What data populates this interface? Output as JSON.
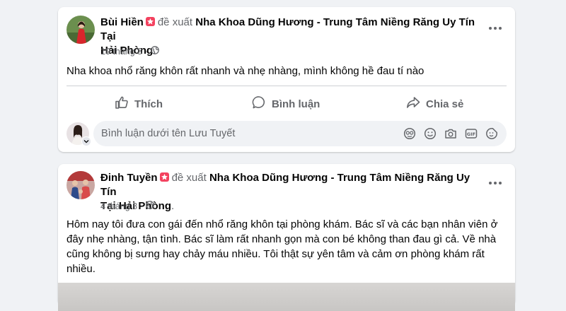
{
  "posts": [
    {
      "author": "Bùi Hiền",
      "verb": "đề xuất",
      "page_line1": "Nha Khoa Dũng Hương - Trung Tâm Niềng Răng Uy Tín Tại",
      "page_line2": "Hải Phòng",
      "date": "10 tháng 8",
      "separator": "·",
      "text_lines": [
        "Nha khoa nhổ răng khôn rất nhanh và nhẹ nhàng, mình không hề đau tí nào"
      ],
      "actions": {
        "like": "Thích",
        "comment": "Bình luận",
        "share": "Chia sẻ"
      },
      "comment_placeholder": "Bình luận dưới tên Lưu Tuyết",
      "comment_icons": [
        "sticker-avatar-icon",
        "emoji-icon",
        "camera-icon",
        "gif-icon",
        "sticker-icon"
      ]
    },
    {
      "author": "Đinh Tuyền",
      "verb": "đề xuất",
      "page_line1": "Nha Khoa Dũng Hương - Trung Tâm Niềng Răng Uy Tín",
      "page_line2": "Tại Hải Phòng",
      "date": "4 tháng 8",
      "separator": "·",
      "text_lines": [
        "Hôm nay tôi đưa con gái đến nhổ răng khôn tại phòng khám. Bác sĩ và các bạn nhân viên ở",
        "đây nhẹ nhàng, tận tình. Bác sĩ làm rất nhanh gọn mà con bé không than đau gì cả. Về nhà",
        "cũng không bị sưng hay chảy máu nhiều. Tôi thật sự yên tâm và cảm ơn phòng khám rất",
        "nhiều."
      ]
    }
  ],
  "colors": {
    "recommend": "#f3425f",
    "muted": "#65676b",
    "background": "#f0f2f5"
  }
}
